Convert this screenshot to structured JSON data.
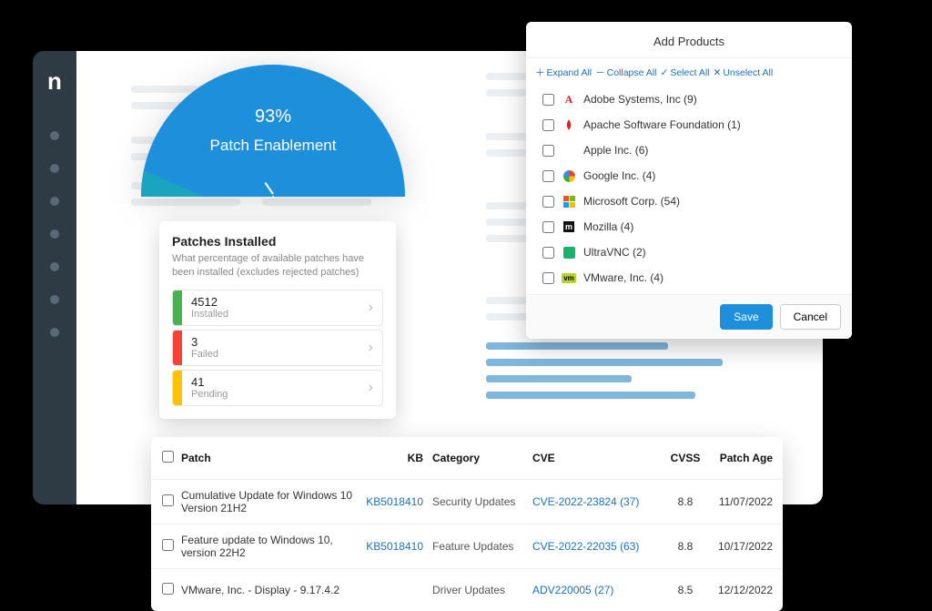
{
  "sidebar": {
    "logo": "n"
  },
  "gauge": {
    "percent": "93%",
    "label": "Patch Enablement"
  },
  "patches_card": {
    "title": "Patches Installed",
    "description": "What percentage of available patches have been installed (excludes rejected patches)",
    "items": [
      {
        "value": "4512",
        "label": "Installed",
        "color": "green"
      },
      {
        "value": "3",
        "label": "Failed",
        "color": "red"
      },
      {
        "value": "41",
        "label": "Pending",
        "color": "yellow"
      }
    ]
  },
  "modal": {
    "title": "Add Products",
    "actions": {
      "expand": "Expand All",
      "collapse": "Collapse All",
      "select": "Select All",
      "unselect": "Unselect All"
    },
    "products": [
      {
        "name": "Adobe Systems, Inc (9)",
        "icon": "adobe"
      },
      {
        "name": "Apache Software Foundation (1)",
        "icon": "feather"
      },
      {
        "name": "Apple Inc. (6)",
        "icon": "apple"
      },
      {
        "name": "Google Inc. (4)",
        "icon": "google"
      },
      {
        "name": "Microsoft Corp. (54)",
        "icon": "ms"
      },
      {
        "name": "Mozilla (4)",
        "icon": "moz"
      },
      {
        "name": "UltraVNC (2)",
        "icon": "uvnc"
      },
      {
        "name": "VMware, Inc. (4)",
        "icon": "vmw"
      }
    ],
    "buttons": {
      "save": "Save",
      "cancel": "Cancel"
    }
  },
  "table": {
    "headers": {
      "patch": "Patch",
      "kb": "KB",
      "category": "Category",
      "cve": "CVE",
      "cvss": "CVSS",
      "age": "Patch Age"
    },
    "rows": [
      {
        "patch": "Cumulative Update for Windows 10 Version 21H2",
        "kb": "KB5018410",
        "category": "Security Updates",
        "cve": "CVE-2022-23824 (37)",
        "cvss": "8.8",
        "age": "11/07/2022"
      },
      {
        "patch": "Feature update to Windows 10, version 22H2",
        "kb": "KB5018410",
        "category": "Feature Updates",
        "cve": "CVE-2022-22035 (63)",
        "cvss": "8.8",
        "age": "10/17/2022"
      },
      {
        "patch": "VMware, Inc. - Display - 9.17.4.2",
        "kb": "",
        "category": "Driver Updates",
        "cve": "ADV220005 (27)",
        "cvss": "8.5",
        "age": "12/12/2022"
      }
    ]
  }
}
